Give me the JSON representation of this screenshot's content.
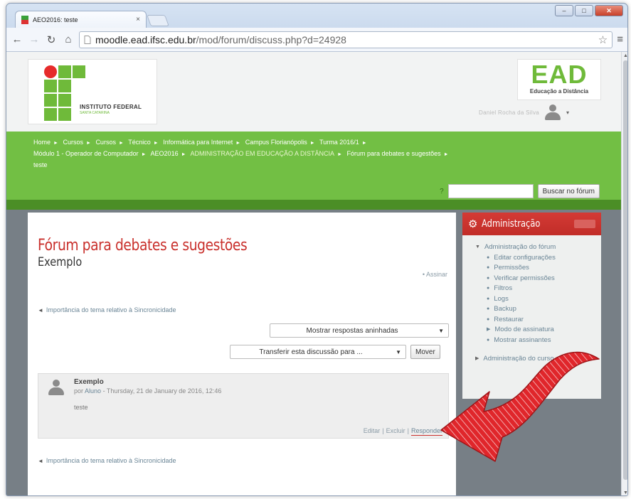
{
  "browser": {
    "tab_title": "AEO2016: teste",
    "tab_close": "×",
    "url_host": "moodle.ead.ifsc.edu.br",
    "url_path": "/mod/forum/discuss.php?d=24928",
    "window_buttons": {
      "minimize": "–",
      "maximize": "□",
      "close": "✕"
    },
    "icons": {
      "back": "arrow-left-icon",
      "forward": "arrow-right-icon",
      "reload": "reload-icon",
      "home": "home-icon",
      "bookmark": "star-icon",
      "menu": "menu-icon"
    }
  },
  "header": {
    "institution_name": "INSTITUTO FEDERAL",
    "institution_sub": "SANTA CATARINA",
    "ead_title": "EAD",
    "ead_sub": "Educação a Distância",
    "user_name": "Daniel Rocha da Silva",
    "user_caret": "▾"
  },
  "breadcrumbs": {
    "items": [
      "Home",
      "Cursos",
      "Cursos",
      "Técnico",
      "Informática para Internet",
      "Campus Florianópolis",
      "Turma 2016/1",
      "Módulo 1 - Operador de Computador",
      "AEO2016",
      "ADMINISTRAÇÃO EM EDUCAÇÃO A DISTÂNCIA",
      "Fórum para debates e sugestões",
      "teste"
    ],
    "separator": "►"
  },
  "search": {
    "icon": "help-icon",
    "icon_glyph": "?",
    "value": "",
    "button_label": "Buscar no fórum"
  },
  "forum": {
    "title": "Fórum para debates e sugestões",
    "discussion_title": "Exemplo",
    "subscribe_link": "• Assinar",
    "prev_link": "Importância do tema relativo à Sincronicidade",
    "display_mode": "Mostrar respostas aninhadas",
    "move_select": "Transferir esta discussão para ...",
    "move_button": "Mover",
    "post": {
      "subject": "Exemplo",
      "author_prefix": "por",
      "author": "Aluno",
      "date": "- Thursday, 21 de January de 2016, 12:46",
      "body": "teste",
      "commands": [
        "Editar",
        "Excluir",
        "Responder"
      ]
    },
    "next_link": "Importância do tema relativo à Sincronicidade"
  },
  "admin_block": {
    "title": "Administração",
    "forum_admin_label": "Administração do fórum",
    "items": [
      "Editar configurações",
      "Permissões",
      "Verificar permissões",
      "Filtros",
      "Logs",
      "Backup",
      "Restaurar",
      "Modo de assinatura",
      "Mostrar assinantes"
    ],
    "course_admin_label": "Administração do curso"
  },
  "colors": {
    "green": "#72bf44",
    "dark_green": "#4b8e26",
    "red": "#c9302c",
    "link": "#6a8596"
  }
}
